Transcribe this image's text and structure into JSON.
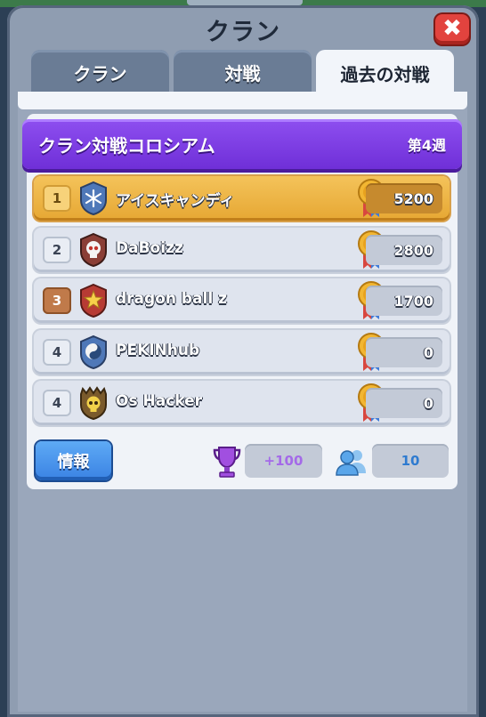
{
  "header": {
    "title": "クラン",
    "close_label": "✖"
  },
  "tabs": [
    {
      "label": "クラン",
      "active": false
    },
    {
      "label": "対戦",
      "active": false
    },
    {
      "label": "過去の対戦",
      "active": true
    }
  ],
  "banner": {
    "name": "クラン対戦コロシアム",
    "week": "第4週"
  },
  "rows": [
    {
      "rank": "1",
      "name": "アイスキャンディ",
      "score": "5200",
      "badge": "snowflake-badge"
    },
    {
      "rank": "2",
      "name": "DaBoizz",
      "score": "2800",
      "badge": "skull-badge"
    },
    {
      "rank": "3",
      "name": "dragon ball z",
      "score": "1700",
      "badge": "star-badge"
    },
    {
      "rank": "4",
      "name": "PEKINhub",
      "score": "0",
      "badge": "yin-yang-badge"
    },
    {
      "rank": "4",
      "name": "Os Hacker",
      "score": "0",
      "badge": "skull-crown-badge"
    }
  ],
  "footer": {
    "info_label": "情報",
    "trophy_value": "+100",
    "members_value": "10"
  },
  "colors": {
    "banner": "#7a3ae0",
    "gold_row": "#f0b84a",
    "info_button": "#4a92ea"
  }
}
